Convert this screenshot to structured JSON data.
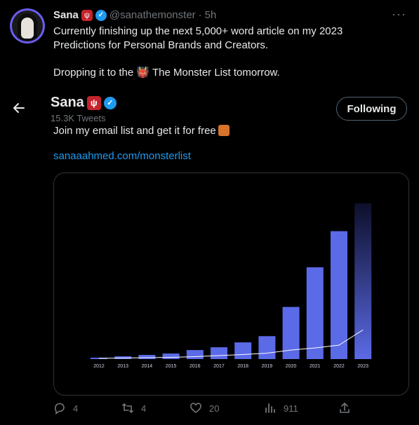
{
  "tweet": {
    "author": {
      "name": "Sana",
      "handle": "@sanathemonster",
      "time": "5h"
    },
    "text_line1": "Currently finishing up the next 5,000+ word article on my 2023 Predictions for Personal Brands and Creators.",
    "text_line2": "Dropping it to the 👹 The Monster List tomorrow.",
    "text_line3": "Join my email list and get it for free",
    "link": "sanaaahmed.com/monsterlist"
  },
  "overlay": {
    "name": "Sana",
    "subtitle": "15.3K Tweets",
    "follow_label": "Following"
  },
  "actions": {
    "replies": "4",
    "retweets": "4",
    "likes": "20",
    "views": "911"
  },
  "colors": {
    "accent": "#1d9bf0",
    "bar": "#5b6ae6",
    "line": "#ffffff"
  },
  "chart_data": {
    "type": "bar",
    "categories": [
      "2012",
      "2013",
      "2014",
      "2015",
      "2016",
      "2017",
      "2018",
      "2019",
      "2020",
      "2021",
      "2022",
      "2023"
    ],
    "values": [
      2,
      4,
      6,
      8,
      13,
      17,
      24,
      33,
      75,
      132,
      184,
      224
    ],
    "line_values": [
      1,
      1.5,
      2,
      2.5,
      3.5,
      5,
      6.5,
      8.5,
      13,
      16,
      20,
      42
    ],
    "last_bar_faded": true,
    "ylim": [
      0,
      230
    ],
    "grid": false,
    "title": "",
    "xlabel": "",
    "ylabel": ""
  }
}
